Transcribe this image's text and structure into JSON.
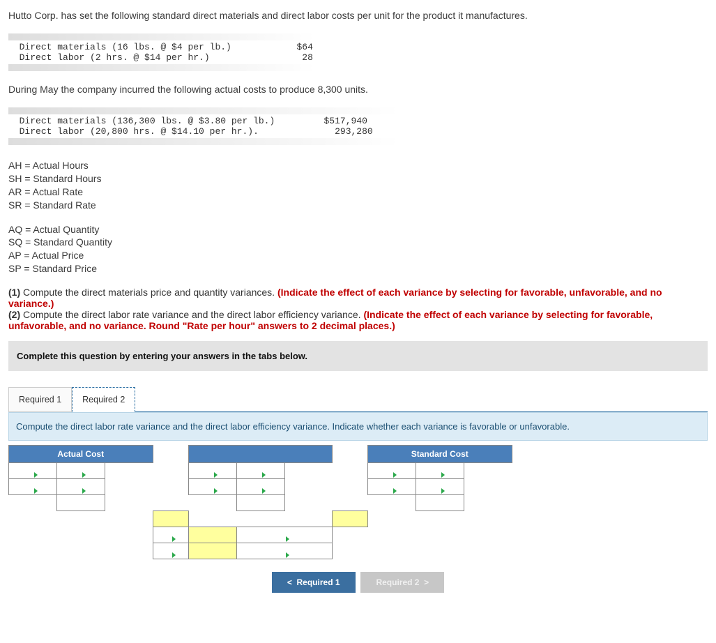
{
  "intro": "Hutto Corp. has set the following standard direct materials and direct labor costs per unit for the product it manufactures.",
  "std_block": {
    "line1_desc": "Direct materials (16 lbs. @ $4 per lb.)",
    "line1_val": "$64",
    "line2_desc": "Direct labor (2 hrs. @ $14 per hr.)",
    "line2_val": "28"
  },
  "during_text": "During May the company incurred the following actual costs to produce 8,300 units.",
  "act_block": {
    "line1_desc": "Direct materials (136,300 lbs. @ $3.80 per lb.)",
    "line1_val": "$517,940",
    "line2_desc": "Direct labor (20,800 hrs. @ $14.10 per hr.).",
    "line2_val": "293,280"
  },
  "defs1": [
    "AH = Actual Hours",
    "SH = Standard Hours",
    "AR = Actual Rate",
    "SR = Standard Rate"
  ],
  "defs2": [
    "AQ = Actual Quantity",
    "SQ = Standard Quantity",
    "AP = Actual Price",
    "SP = Standard Price"
  ],
  "instr": {
    "p1_lead": "(1) ",
    "p1_text": "Compute the direct materials price and quantity variances. ",
    "p1_red": "(Indicate the effect of each variance by selecting for favorable, unfavorable, and no variance.)",
    "p2_lead": "(2) ",
    "p2_text": "Compute the direct labor rate variance and the direct labor efficiency variance. ",
    "p2_red": "(Indicate the effect of each variance by selecting for favorable, unfavorable, and no variance. Round \"Rate per hour\" answers to 2 decimal places.)"
  },
  "complete_bar": "Complete this question by entering your answers in the tabs below.",
  "tabs": {
    "t1": "Required 1",
    "t2": "Required 2"
  },
  "panel_instruction": "Compute the direct labor rate variance and the direct labor efficiency variance. Indicate whether each variance is favorable or unfavorable.",
  "table": {
    "actual_cost": "Actual Cost",
    "standard_cost": "Standard Cost"
  },
  "nav": {
    "prev": "Required 1",
    "next": "Required 2"
  }
}
